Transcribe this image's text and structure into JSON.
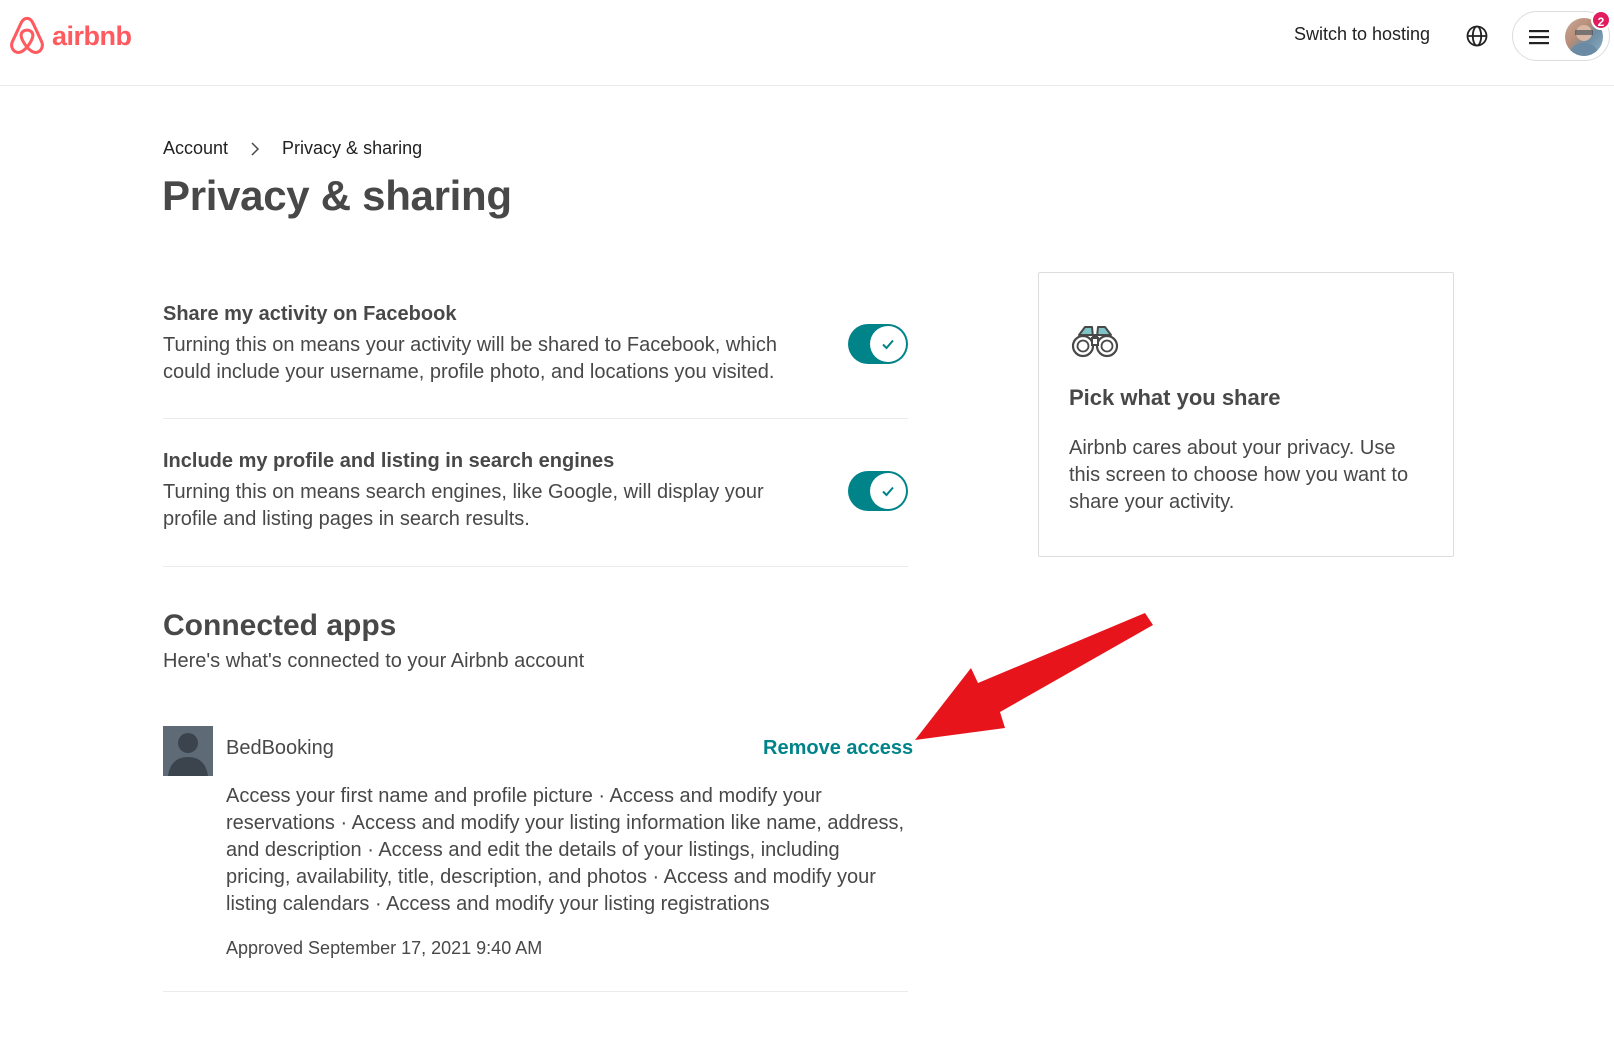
{
  "header": {
    "logo_text": "airbnb",
    "switch_hosting_label": "Switch to hosting",
    "notification_count": "2",
    "brand_color": "#ff5a5f"
  },
  "breadcrumb": {
    "items": [
      "Account",
      "Privacy & sharing"
    ]
  },
  "page_title": "Privacy & sharing",
  "settings": [
    {
      "title": "Share my activity on Facebook",
      "description": "Turning this on means your activity will be shared to Facebook, which could include your username, profile photo, and locations you visited.",
      "enabled": true
    },
    {
      "title": "Include my profile and listing in search engines",
      "description": "Turning this on means search engines, like Google, will display your profile and listing pages in search results.",
      "enabled": true
    }
  ],
  "info_card": {
    "icon": "binoculars-icon",
    "title": "Pick what you share",
    "description": "Airbnb cares about your privacy. Use this screen to choose how you want to share your activity."
  },
  "connected_apps": {
    "title": "Connected apps",
    "subtitle": "Here's what's connected to your Airbnb account",
    "apps": [
      {
        "name": "BedBooking",
        "action_label": "Remove access",
        "permissions": "Access your first name and profile picture · Access and modify your reservations · Access and modify your listing information like name, address, and description · Access and edit the details of your listings, including pricing, availability, title, description, and photos · Access and modify your listing calendars · Access and modify your listing registrations",
        "approved": "Approved September 17, 2021 9:40 AM"
      }
    ]
  },
  "colors": {
    "accent": "#008489",
    "text": "#484848",
    "annotation_arrow": "#e8141c"
  }
}
